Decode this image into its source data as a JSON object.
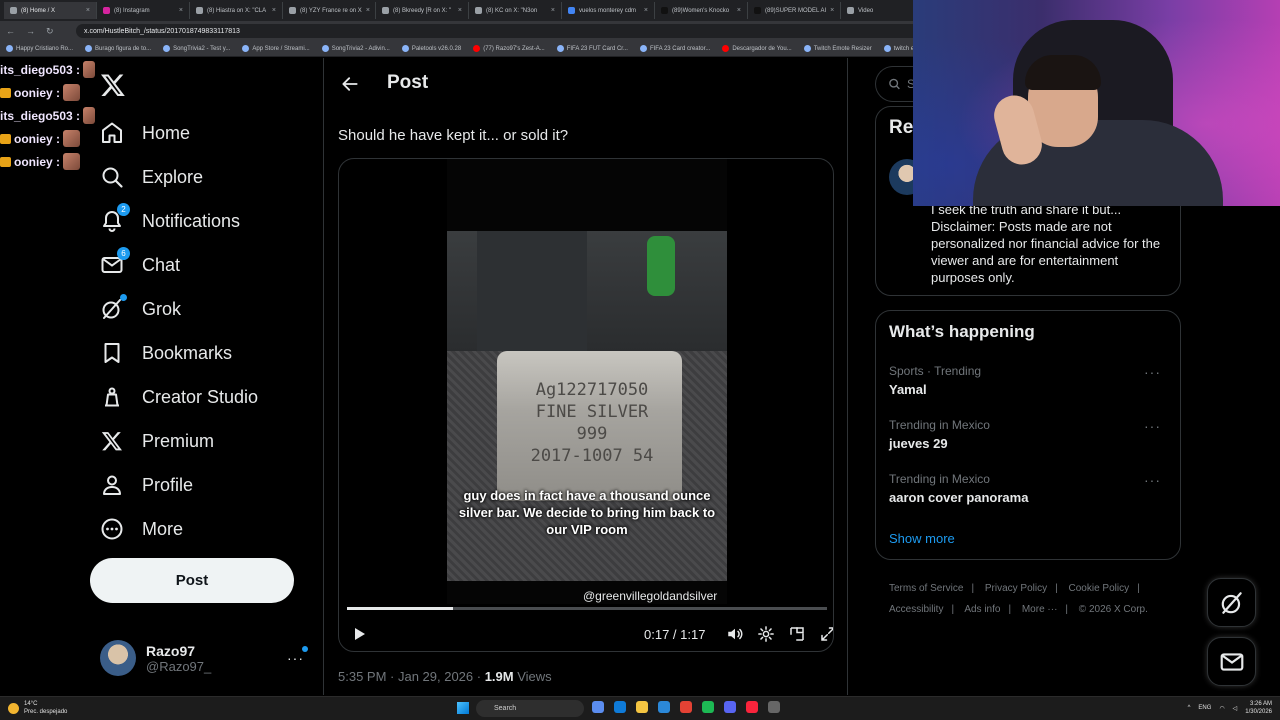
{
  "browser": {
    "tabs": [
      "(8) Home / X",
      "(8) Instagram",
      "(8) Hiastra on X: \"CLA",
      "(8) YZY France re on X",
      "(8) Bkreedy [R on X: \"",
      "(8) KC on X: \"N3on",
      "vuelos monterey cdm",
      "(89)Women's Knocko",
      "(89)SUPER MODEL AI",
      "Video"
    ],
    "url": "x.com/HustleBitch_/status/2017018749833117813",
    "bookmarks": [
      "Happy Cristiano Ro...",
      "Burago figura de to...",
      "SongTrivia2 - Test y...",
      "App Store / Streami...",
      "SongTrivia2 - Adivin...",
      "Paletools v26.0.28",
      "(77) Razo97's Zest-A...",
      "FIFA 23 FUT Card Cr...",
      "FIFA 23 Card creator...",
      "Descargador de You...",
      "Twitch Emote Resizer",
      "twitch emote re"
    ]
  },
  "chat": [
    {
      "user": "its_diego503 :",
      "crown": false
    },
    {
      "user": "ooniey :",
      "crown": true
    },
    {
      "user": "its_diego503 :",
      "crown": false
    },
    {
      "user": "ooniey :",
      "crown": true
    },
    {
      "user": "ooniey :",
      "crown": true
    }
  ],
  "nav": {
    "items": [
      {
        "label": "Home",
        "icon": "home-icon",
        "bold": false
      },
      {
        "label": "Explore",
        "icon": "search-icon",
        "bold": false
      },
      {
        "label": "Notifications",
        "icon": "bell-icon",
        "badge": "2"
      },
      {
        "label": "Chat",
        "icon": "mail-icon",
        "badge": "6"
      },
      {
        "label": "Grok",
        "icon": "grok-icon",
        "dot": true
      },
      {
        "label": "Bookmarks",
        "icon": "bookmark-icon"
      },
      {
        "label": "Creator Studio",
        "icon": "creator-studio-icon"
      },
      {
        "label": "Premium",
        "icon": "x-premium-icon"
      },
      {
        "label": "Profile",
        "icon": "profile-icon"
      },
      {
        "label": "More",
        "icon": "more-circle-icon"
      }
    ],
    "post_button": "Post"
  },
  "account": {
    "name": "Razo97",
    "handle": "@Razo97_"
  },
  "main": {
    "title": "Post",
    "text": "Should he have kept it... or sold it?",
    "video": {
      "engraving": [
        "Ag122717050",
        "FINE SILVER",
        "999",
        "2017-1007 54"
      ],
      "caption": "guy does in fact have a thousand ounce silver bar. We decide to bring him back to our VIP room",
      "watermark": "@greenvillegoldandsilver",
      "time": "0:17 / 1:17",
      "progress": 0.22
    },
    "meta_time": "5:35 PM · Jan 29, 2026 · ",
    "views_count": "1.9M",
    "views_label": " Views"
  },
  "right": {
    "search_placeholder": "S",
    "relevant_title": "Rel",
    "relevant_bio": "I seek the truth and share it but... Disclaimer: Posts made are not personalized nor financial advice for the viewer and are for entertainment purposes only.",
    "happening_title": "What’s happening",
    "trends": [
      {
        "context": "Sports · Trending",
        "name": "Yamal"
      },
      {
        "context": "Trending in Mexico",
        "name": "jueves 29"
      },
      {
        "context": "Trending in Mexico",
        "name": "aaron cover panorama"
      }
    ],
    "show_more": "Show more",
    "footer": {
      "terms": "Terms of Service",
      "privacy": "Privacy Policy",
      "cookie": "Cookie Policy",
      "accessibility": "Accessibility",
      "ads": "Ads info",
      "more": "More ···",
      "copyright": "© 2026 X Corp."
    }
  },
  "taskbar": {
    "temp": "14°C",
    "weather": "Prec. despejado",
    "search": "Search",
    "lang": "ENG",
    "time": "3:26 AM",
    "date": "1/30/2026"
  },
  "colors": {
    "accent": "#1d9bf0",
    "bg": "#000000",
    "border": "#2f3336",
    "muted": "#71767b"
  }
}
